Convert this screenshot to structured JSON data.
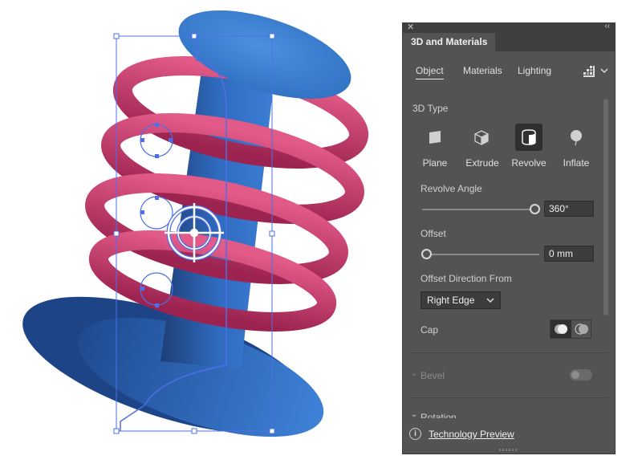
{
  "panel": {
    "title": "3D and Materials",
    "close_icon": "close-icon",
    "collapse_icon": "double-chevron-icon",
    "tabs": [
      {
        "label": "Object",
        "active": true
      },
      {
        "label": "Materials",
        "active": false
      },
      {
        "label": "Lighting",
        "active": false
      }
    ],
    "render_icon": "render-icon",
    "three_d_type": {
      "label": "3D Type",
      "options": [
        {
          "label": "Plane",
          "icon": "plane-icon",
          "selected": false
        },
        {
          "label": "Extrude",
          "icon": "extrude-icon",
          "selected": false
        },
        {
          "label": "Revolve",
          "icon": "revolve-icon",
          "selected": true
        },
        {
          "label": "Inflate",
          "icon": "inflate-icon",
          "selected": false
        }
      ]
    },
    "revolve_angle": {
      "label": "Revolve Angle",
      "value": "360°",
      "fraction": 1.0
    },
    "offset": {
      "label": "Offset",
      "value": "0 mm",
      "fraction": 0.0
    },
    "offset_direction": {
      "label": "Offset Direction From",
      "selected": "Right Edge"
    },
    "cap": {
      "label": "Cap",
      "selected_index": 0
    },
    "bevel": {
      "label": "Bevel",
      "enabled": false
    },
    "rotation": {
      "label": "Rotation"
    },
    "footer": {
      "link_label": "Technology Preview",
      "icon": "info-icon"
    }
  },
  "colors": {
    "panel_bg": "#535353",
    "object_blue": "#3f7fd0",
    "spring_pink": "#d4386a",
    "selection_blue": "#4d6fe8"
  }
}
